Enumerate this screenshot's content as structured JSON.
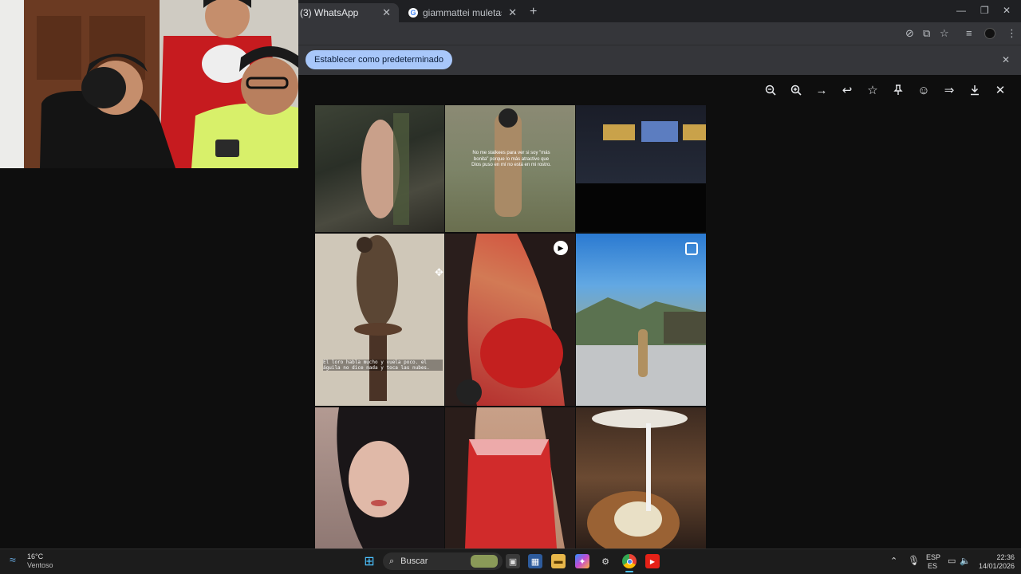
{
  "browser": {
    "tabs": [
      {
        "label": "(3) WhatsApp",
        "active": true
      },
      {
        "label": "giammattei muletas - Buscar con Google",
        "active": false
      }
    ],
    "new_tab_icon": "plus-icon",
    "infobar": {
      "default_button": "Establecer como predeterminado",
      "close_icon": "close-icon"
    }
  },
  "viewer": {
    "toolbar_icons": [
      "zoom-out-icon",
      "zoom-in-icon",
      "forward-arrow-icon",
      "reply-icon",
      "star-icon",
      "pin-icon",
      "emoji-icon",
      "share-icon",
      "download-icon",
      "close-icon"
    ]
  },
  "grid": {
    "captions": {
      "caption_quote": "No me stalkees para ver si soy \"más bonita\" porque lo más atractivo que Dios puso en mí no está en mi rostro.",
      "caption_bird": "El loro habla mucho y vuela poco. el águila no dice nada y toca las nubes."
    }
  },
  "taskbar": {
    "weather_temp": "16°C",
    "weather_desc": "Ventoso",
    "search_placeholder": "Buscar",
    "lang_top": "ESP",
    "lang_bottom": "ES",
    "time": "22:36",
    "date": "14/01/2026"
  },
  "colors": {
    "accent": "#a8c7fa",
    "chrome_dark": "#1f2023",
    "chrome_mid": "#35363a"
  }
}
